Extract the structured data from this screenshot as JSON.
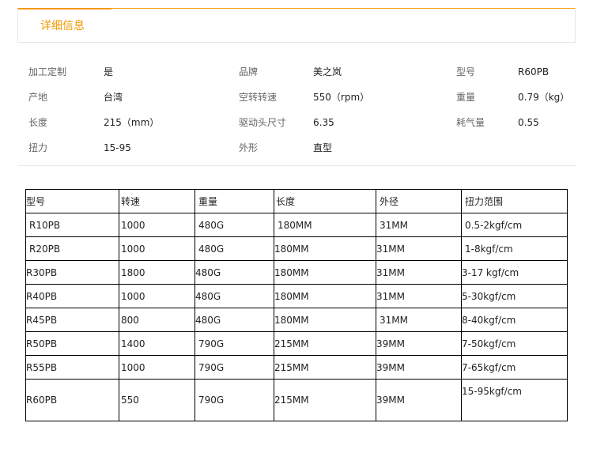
{
  "header": {
    "title": "详细信息"
  },
  "info": [
    [
      {
        "label": "加工定制",
        "value": "是"
      },
      {
        "label": "品牌",
        "value": "美之岚"
      },
      {
        "label": "型号",
        "value": "R60PB"
      }
    ],
    [
      {
        "label": "产地",
        "value": "台湾"
      },
      {
        "label": "空转转速",
        "value": "550（rpm）"
      },
      {
        "label": "重量",
        "value": "0.79（kg）"
      }
    ],
    [
      {
        "label": "长度",
        "value": "215（mm）"
      },
      {
        "label": "驱动头尺寸",
        "value": "6.35"
      },
      {
        "label": "耗气量",
        "value": "0.55"
      }
    ],
    [
      {
        "label": "扭力",
        "value": "15-95"
      },
      {
        "label": "外形",
        "value": "直型"
      }
    ]
  ],
  "table": {
    "headers": [
      "型号",
      "转速",
      "重量",
      "长度",
      "外径",
      "扭力范围"
    ],
    "rows": [
      [
        "R10PB",
        "1000",
        "480G",
        "180MM",
        "31MM",
        "0.5-2kgf/cm"
      ],
      [
        "R20PB",
        "1000",
        "480G",
        "180MM",
        "31MM",
        "1-8kgf/cm"
      ],
      [
        "R30PB",
        "1800",
        "480G",
        "180MM",
        "31MM",
        "3-17 kgf/cm"
      ],
      [
        "R40PB",
        "1000",
        "480G",
        "180MM",
        "31MM",
        "5-30kgf/cm"
      ],
      [
        "R45PB",
        "800",
        "480G",
        "180MM",
        "31MM",
        "8-40kgf/cm"
      ],
      [
        "R50PB",
        "1400",
        "790G",
        "215MM",
        "39MM",
        "7-50kgf/cm"
      ],
      [
        "R55PB",
        "1000",
        "790G",
        "215MM",
        "39MM",
        "7-65kgf/cm"
      ],
      [
        "R60PB",
        "550",
        "790G",
        "215MM",
        "39MM",
        "15-95kgf/cm"
      ]
    ]
  }
}
